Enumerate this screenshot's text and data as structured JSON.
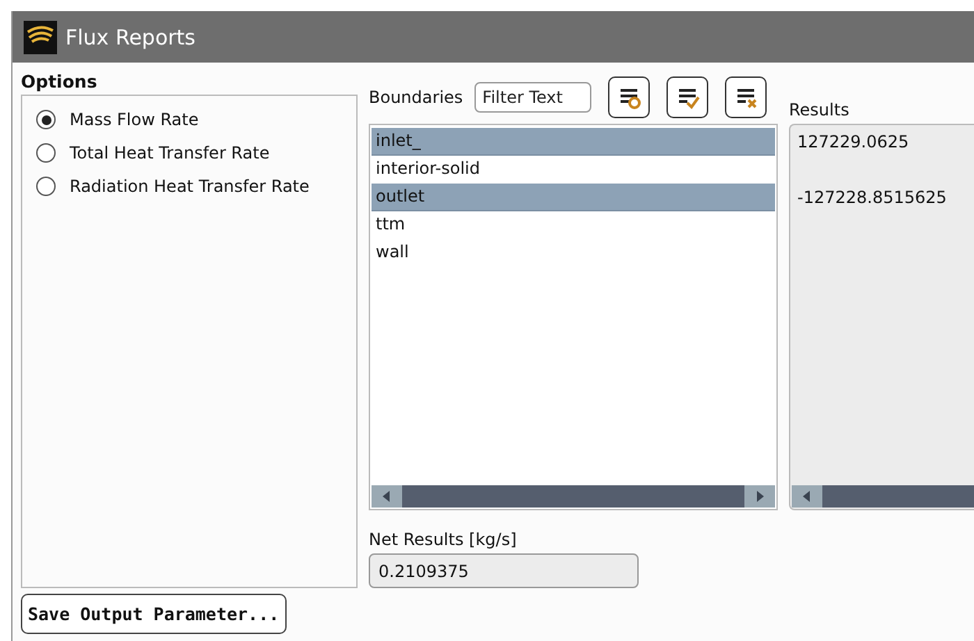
{
  "window": {
    "title": "Flux Reports"
  },
  "options": {
    "title": "Options",
    "items": [
      {
        "label": "Mass Flow Rate",
        "selected": true
      },
      {
        "label": "Total Heat Transfer Rate",
        "selected": false
      },
      {
        "label": "Radiation Heat Transfer Rate",
        "selected": false
      }
    ]
  },
  "boundaries": {
    "label": "Boundaries",
    "filter": {
      "placeholder": "Filter Text"
    },
    "items": [
      {
        "name": "inlet_",
        "selected": true,
        "result": "127229.0625"
      },
      {
        "name": "interior-solid",
        "selected": false
      },
      {
        "name": "outlet",
        "selected": true,
        "result": "-127228.8515625"
      },
      {
        "name": "ttm",
        "selected": false
      },
      {
        "name": "wall",
        "selected": false
      }
    ]
  },
  "results": {
    "label": "Results"
  },
  "net_results": {
    "label": "Net Results [kg/s]",
    "value": "0.2109375"
  },
  "buttons": [
    "Save Output Parameter..."
  ]
}
